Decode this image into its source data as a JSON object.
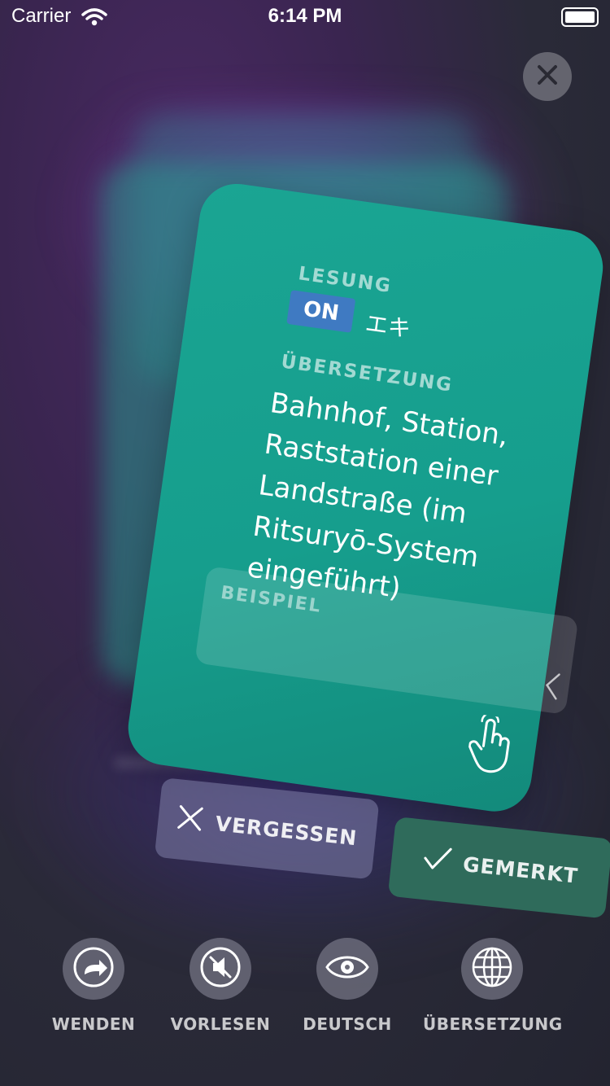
{
  "status_bar": {
    "carrier": "Carrier",
    "time": "6:14 PM"
  },
  "card": {
    "reading_label": "LESUNG",
    "reading_type": "ON",
    "reading_kana": "エキ",
    "translation_label": "ÜBERSETZUNG",
    "translation_text": "Bahnhof, Station, Raststation einer Landstraße (im Ritsuryō-System eingeführt)",
    "example_label": "BEISPIEL"
  },
  "actions": {
    "forget_label": "VERGESSEN",
    "known_label": "GEMERKT"
  },
  "toolbar": {
    "items": [
      {
        "label": "WENDEN",
        "icon": "turn-arrow-icon"
      },
      {
        "label": "VORLESEN",
        "icon": "speaker-muted-icon"
      },
      {
        "label": "DEUTSCH",
        "icon": "eye-icon"
      },
      {
        "label": "ÜBERSETZUNG",
        "icon": "globe-icon"
      }
    ]
  }
}
